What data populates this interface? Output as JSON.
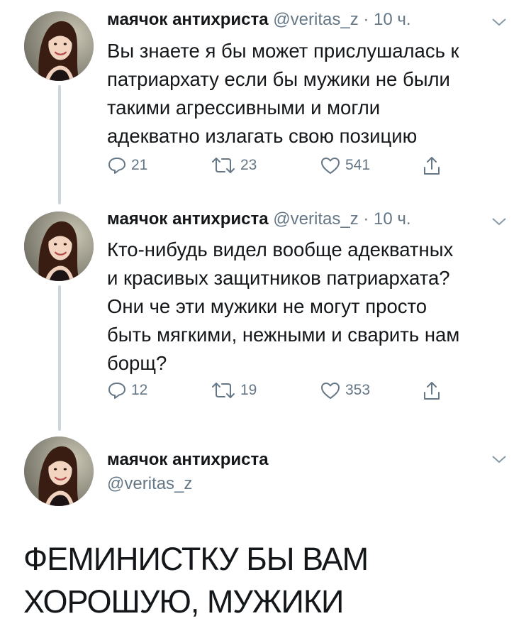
{
  "tweets": [
    {
      "author": "маячок антихриста",
      "meta": "@veritas_z · 10 ч.",
      "text": "Вы знаете я бы может прислушалась к\nпатриархату если бы мужики не были\nтакими агрессивными и могли\nадекватно излагать свою позицию",
      "replies": "21",
      "retweets": "23",
      "likes": "541"
    },
    {
      "author": "маячок антихриста",
      "meta": "@veritas_z · 10 ч.",
      "text": "Кто-нибудь видел вообще адекватных\nи красивых защитников патриархата?\nОни че эти мужики не могут просто\nбыть мягкими, нежными и сварить нам\nборщ?",
      "replies": "12",
      "retweets": "19",
      "likes": "353"
    },
    {
      "author": "маячок антихриста",
      "handle": "@veritas_z"
    }
  ],
  "caption": "ФЕМИНИСТКУ БЫ ВАМ\nХОРОШУЮ, МУЖИКИ",
  "colors": {
    "text": "#14171a",
    "muted": "#657786",
    "thread_line": "#ccd6dd"
  },
  "icons": [
    "reply-icon",
    "retweet-icon",
    "like-icon",
    "share-icon",
    "chevron-down-icon"
  ]
}
